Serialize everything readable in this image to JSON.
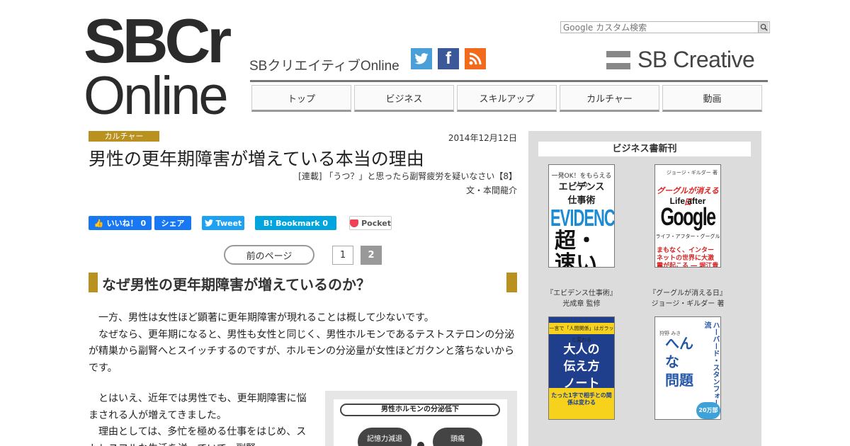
{
  "header": {
    "logo_top": "SBCr",
    "logo_bottom": "Online",
    "site_subtitle": "SBクリエイティブOnline",
    "search_placeholder": "Google カスタム検索",
    "brand": "SB Creative",
    "social": [
      {
        "name": "twitter-icon",
        "glyph": "🐦"
      },
      {
        "name": "facebook-icon",
        "glyph": "f"
      },
      {
        "name": "rss-icon",
        "glyph": "◉"
      }
    ]
  },
  "nav": {
    "items": [
      {
        "label": "トップ"
      },
      {
        "label": "ビジネス"
      },
      {
        "label": "スキルアップ"
      },
      {
        "label": "カルチャー"
      },
      {
        "label": "動画"
      }
    ]
  },
  "article": {
    "category": "カルチャー",
    "date": "2014年12月12日",
    "title": "男性の更年期障害が増えている本当の理由",
    "series": "[連載] 「うつ？」と思ったら副腎疲労を疑いなさい【8】",
    "author": "文・本間龍介",
    "share": {
      "fb_like": "いいね！ 0",
      "fb_share": "シェア",
      "tweet": "Tweet",
      "hatena": "B! Bookmark  0",
      "pocket": "Pocket"
    },
    "pager": {
      "prev": "前のページ",
      "pages": [
        "1",
        "2"
      ],
      "current": "2"
    },
    "heading": "なぜ男性の更年期障害が増えているのか？",
    "para1": [
      "一方、男性は女性ほど顕著に更年期障害が現れることは概して少ないです。",
      "なぜなら、更年期になると、男性も女性と同じく、男性ホルモンであるテストステロンの分泌が精巣から副腎へとスイッチするのですが、ホルモンの分泌量が女性ほどガクンと落ちないからです。"
    ],
    "para2": [
      "とはいえ、近年では男性でも、更年期障害に悩まされる人が増えてきました。",
      "理由としては、多忙を極める仕事をはじめ、ストレスフルな生活を送っていて、副腎"
    ],
    "figure": {
      "title": "男性ホルモンの分泌低下",
      "bubble_a": "記憶力減退",
      "bubble_b": "頭痛"
    }
  },
  "sidebar": {
    "title": "ビジネス書新刊",
    "books": [
      {
        "cover_head": "一発OK！をもらえる人の",
        "cover_main": "エビデンス\n仕事術",
        "cover_en": "EVIDENCE",
        "cover_big": "超・\n速い",
        "caption": "『エビデンス仕事術』\n光成章 監修"
      },
      {
        "cover_top": "ジョージ・ギルダー 著",
        "cover_red": "グーグルが消える日",
        "cover_life": "Life after",
        "cover_google": "Google",
        "cover_sub": "ライフ・アフター・グーグル",
        "cover_bottom": "まもなく、インターネットの世界に大激震が起こる ― 堀江貴文氏、推薦!!",
        "caption": "『グーグルが消える日』\nジョージ・ギルダー 著"
      },
      {
        "cover_band": "一言で「人間関係」はガラッと変わる",
        "cover_title": "大人の\n伝え方\nノート",
        "cover_lower": "たった1字で相手との関係は変わる"
      },
      {
        "cover_author": "狩野 みき",
        "cover_big": "へんな\n問題",
        "cover_side": "ハーバード・スタンフォード流",
        "cover_badge": "20万部"
      }
    ]
  },
  "colors": {
    "accent_gold": "#b8911f",
    "facebook": "#1877f2",
    "twitter": "#1da1f2",
    "hatena": "#00a4de",
    "pocket": "#ee4056",
    "sidebar_bg": "#dcdcdc"
  }
}
